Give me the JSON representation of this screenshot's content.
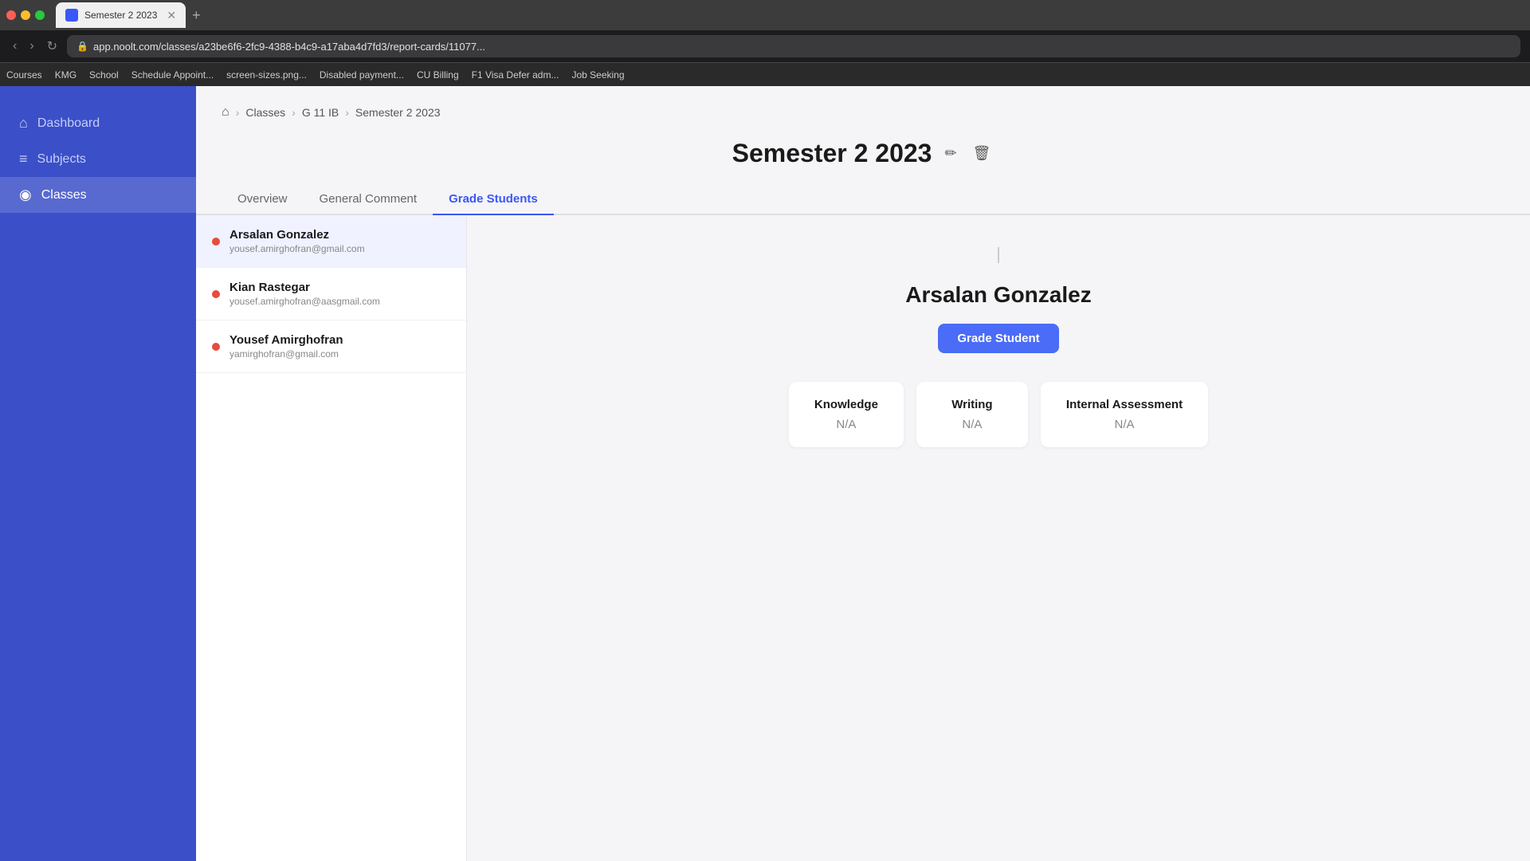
{
  "browser": {
    "tab_title": "Semester 2 2023",
    "url": "app.noolt.com/classes/a23be6f6-2fc9-4388-b4c9-a17aba4d7fd3/report-cards/11077...",
    "bookmarks": [
      "Courses",
      "KMG",
      "School",
      "Schedule Appoint...",
      "screen-sizes.png...",
      "Disabled payment...",
      "CU Billing",
      "F1 Visa Defer adm...",
      "Job Seeking"
    ]
  },
  "sidebar": {
    "items": [
      {
        "label": "Dashboard",
        "icon": "⌂",
        "id": "dashboard",
        "active": false
      },
      {
        "label": "Subjects",
        "icon": "≡",
        "id": "subjects",
        "active": false
      },
      {
        "label": "Classes",
        "icon": "◉",
        "id": "classes",
        "active": true
      }
    ]
  },
  "breadcrumb": {
    "home_icon": "⌂",
    "items": [
      {
        "label": "Classes",
        "id": "classes"
      },
      {
        "label": "G 11 IB",
        "id": "g11ib"
      },
      {
        "label": "Semester 2 2023",
        "id": "semester"
      }
    ]
  },
  "page": {
    "title": "Semester 2 2023",
    "edit_btn_title": "Edit",
    "delete_btn_title": "Delete"
  },
  "tabs": [
    {
      "label": "Overview",
      "id": "overview",
      "active": false
    },
    {
      "label": "General Comment",
      "id": "general-comment",
      "active": false
    },
    {
      "label": "Grade Students",
      "id": "grade-students",
      "active": true
    }
  ],
  "students": [
    {
      "name": "Arsalan Gonzalez",
      "email": "yousef.amirghofran@gmail.com",
      "active": true,
      "dot_color": "#e74c3c"
    },
    {
      "name": "Kian Rastegar",
      "email": "yousef.amirghofran@aasgmail.com",
      "active": false,
      "dot_color": "#e74c3c"
    },
    {
      "name": "Yousef Amirghofran",
      "email": "yamirghofran@gmail.com",
      "active": false,
      "dot_color": "#e74c3c"
    }
  ],
  "student_detail": {
    "name": "Arsalan Gonzalez",
    "grade_btn_label": "Grade Student",
    "grades": [
      {
        "label": "Knowledge",
        "value": "N/A"
      },
      {
        "label": "Writing",
        "value": "N/A"
      },
      {
        "label": "Internal Assessment",
        "value": "N/A"
      }
    ]
  }
}
